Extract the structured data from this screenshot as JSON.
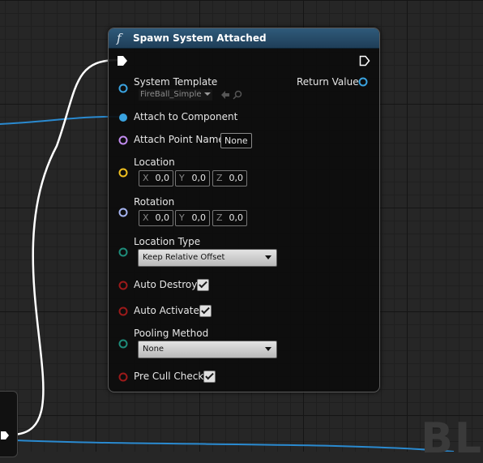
{
  "node": {
    "title": "Spawn System Attached",
    "function_icon": "function-icon"
  },
  "pins": {
    "system_template": {
      "label": "System Template",
      "value": "FireBall_Simple",
      "color": "#3aa3e0"
    },
    "return_value": {
      "label": "Return Value",
      "color": "#3aa3e0"
    },
    "attach_to_component": {
      "label": "Attach to Component",
      "color": "#3aa3e0"
    },
    "attach_point_name": {
      "label": "Attach Point Name",
      "value": "None",
      "color": "#c28cf0"
    },
    "location": {
      "label": "Location",
      "x_axis": "X",
      "x": "0,0",
      "y_axis": "Y",
      "y": "0,0",
      "z_axis": "Z",
      "z": "0,0",
      "color": "#f0c020"
    },
    "rotation": {
      "label": "Rotation",
      "x_axis": "X",
      "x": "0,0",
      "y_axis": "Y",
      "y": "0,0",
      "z_axis": "Z",
      "z": "0,0",
      "color": "#a6b4f0"
    },
    "location_type": {
      "label": "Location Type",
      "value": "Keep Relative Offset",
      "color": "#1e8c7a"
    },
    "auto_destroy": {
      "label": "Auto Destroy",
      "checked": true,
      "color": "#9c1a1a"
    },
    "auto_activate": {
      "label": "Auto Activate",
      "checked": true,
      "color": "#9c1a1a"
    },
    "pooling_method": {
      "label": "Pooling Method",
      "value": "None",
      "color": "#1e8c7a"
    },
    "pre_cull_check": {
      "label": "Pre Cull Check",
      "checked": true,
      "color": "#9c1a1a"
    }
  },
  "colors": {
    "header": "#2f5a7a",
    "exec_wire": "#ffffff",
    "object_wire": "#2a8ad0"
  },
  "watermark": "BL"
}
